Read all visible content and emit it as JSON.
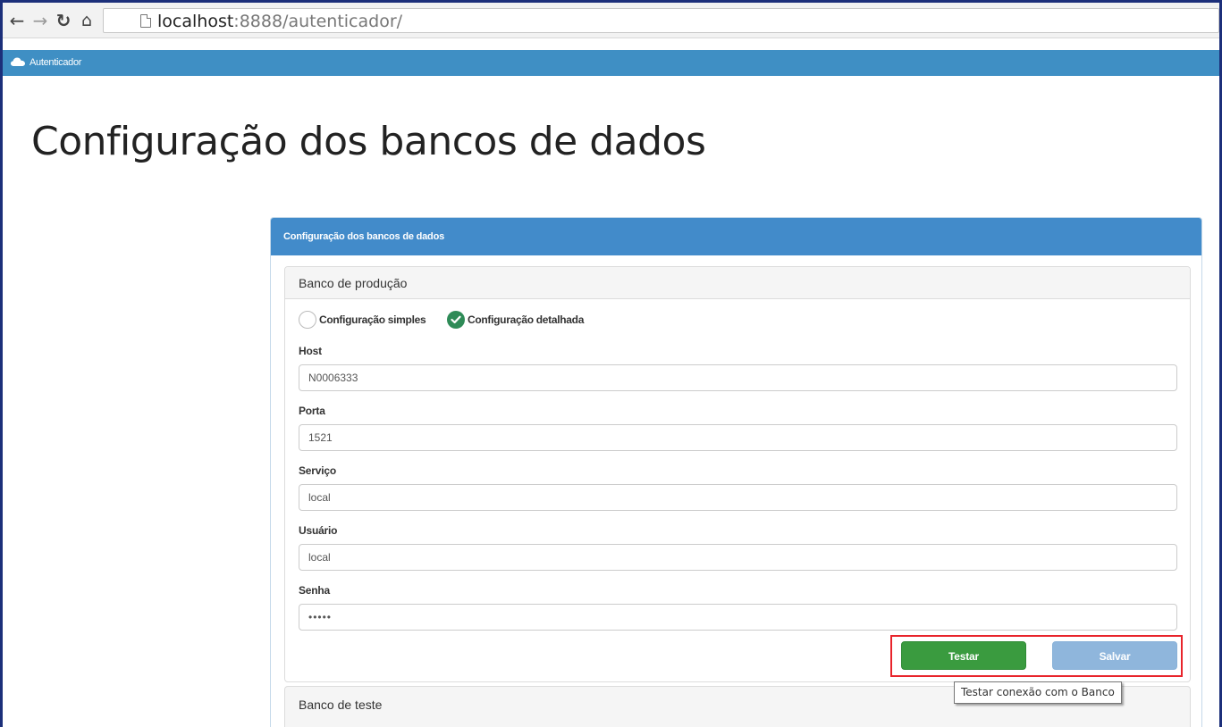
{
  "browser": {
    "back_icon": "arrow-left-icon",
    "forward_icon": "arrow-right-icon",
    "reload_icon": "reload-icon",
    "home_icon": "home-icon",
    "url_host": "localhost",
    "url_rest": ":8888/autenticador/"
  },
  "app": {
    "brand": "Autenticador",
    "brand_icon": "cloud-icon",
    "navbar_color": "#3f8fc4"
  },
  "page": {
    "title": "Configuração dos bancos de dados"
  },
  "panel": {
    "title": "Configuração dos bancos de dados",
    "production": {
      "title": "Banco de produção",
      "options": {
        "simple": "Configuração simples",
        "detailed": "Configuração detalhada",
        "selected": "detailed"
      },
      "fields": {
        "host": {
          "label": "Host",
          "value": "N0006333"
        },
        "porta": {
          "label": "Porta",
          "value": "1521"
        },
        "servico": {
          "label": "Serviço",
          "value": "local"
        },
        "usuario": {
          "label": "Usuário",
          "value": "local"
        },
        "senha": {
          "label": "Senha",
          "value": "•••••"
        }
      },
      "buttons": {
        "testar": "Testar",
        "salvar": "Salvar"
      }
    },
    "test_bank": {
      "title": "Banco de teste"
    }
  },
  "tooltip": {
    "text": "Testar conexão com o Banco"
  },
  "colors": {
    "primary": "#428bca",
    "success": "#3a9b3f",
    "disabled_primary": "#8fb6dc",
    "highlight": "#e8242b"
  }
}
